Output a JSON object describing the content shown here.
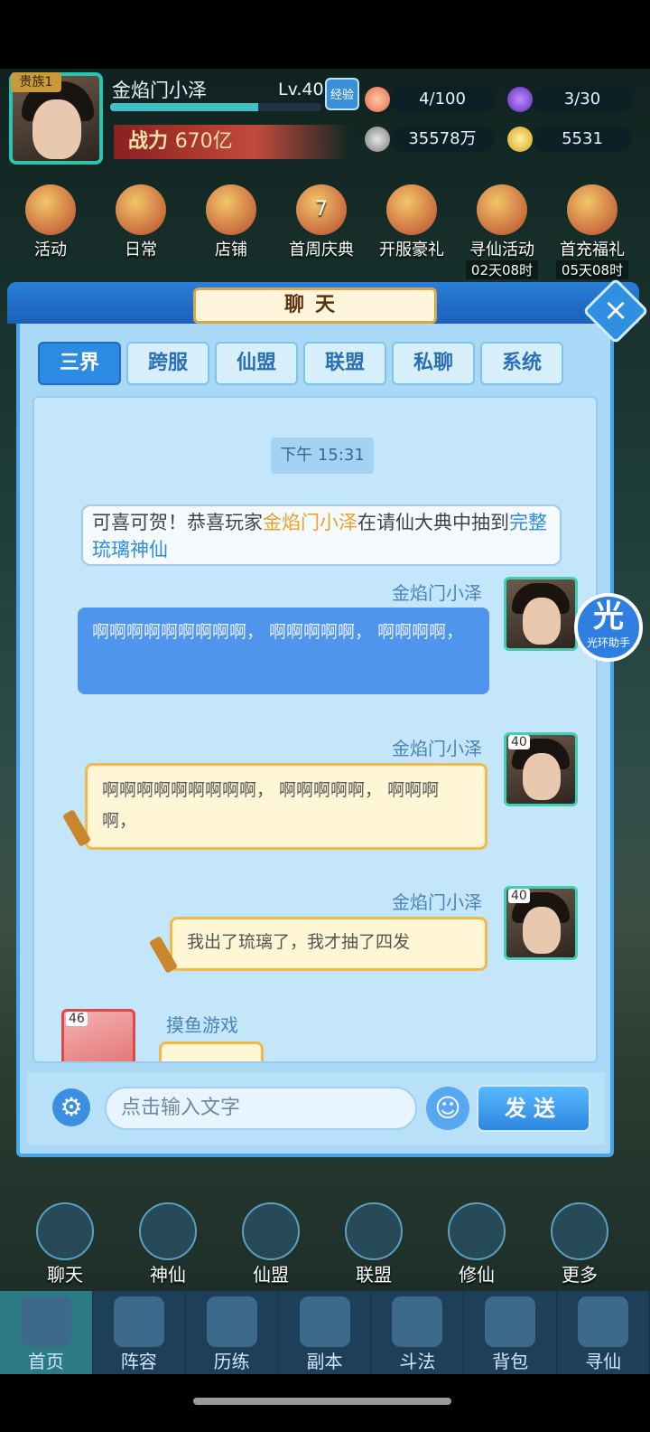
{
  "header": {
    "noble_label": "贵族1",
    "player_name": "金焰门小泽",
    "level": "Lv.40",
    "exp_badge": "经验",
    "exp_progress": 0.7,
    "power_label": "战力",
    "power_value": "670亿",
    "resources": {
      "stamina": "4/100",
      "spirit": "3/30",
      "silver": "35578万",
      "gold": "5531"
    }
  },
  "activities": [
    {
      "label": "活动"
    },
    {
      "label": "日常"
    },
    {
      "label": "店铺"
    },
    {
      "label": "首周庆典",
      "badge": "7"
    },
    {
      "label": "开服豪礼"
    },
    {
      "label": "寻仙活动",
      "timer": "02天08时"
    },
    {
      "label": "首充福礼",
      "timer": "05天08时"
    }
  ],
  "chat": {
    "title": "聊天",
    "close_icon": "×",
    "tabs": [
      "三界",
      "跨服",
      "仙盟",
      "联盟",
      "私聊",
      "系统"
    ],
    "active_tab": "三界",
    "timestamp": "下午 15:31",
    "system_message": {
      "prefix": "可喜可贺！恭喜玩家",
      "player": "金焰门小泽",
      "middle": "在请仙大典中抽到",
      "item": "完整琉璃神仙"
    },
    "messages": [
      {
        "sender": "金焰门小泽",
        "text": "啊啊啊啊啊啊啊啊啊，  啊啊啊啊啊，  啊啊啊啊，",
        "style": "blue"
      },
      {
        "sender": "金焰门小泽",
        "level": "40",
        "text": "啊啊啊啊啊啊啊啊啊，  啊啊啊啊啊，  啊啊啊啊，",
        "style": "gold"
      },
      {
        "sender": "金焰门小泽",
        "level": "40",
        "text": "我出了琉璃了，我才抽了四发",
        "style": "gold"
      },
      {
        "sender": "摸鱼游戏",
        "level": "46",
        "text": "",
        "style": "gold"
      }
    ],
    "input_placeholder": "点击输入文字",
    "send_label": "发送",
    "assistant_label": "光环助手",
    "assistant_glyph": "光"
  },
  "quick_menu": [
    "聊天",
    "神仙",
    "仙盟",
    "联盟",
    "修仙",
    "更多"
  ],
  "bottom_nav": [
    "首页",
    "阵容",
    "历练",
    "副本",
    "斗法",
    "背包",
    "寻仙"
  ],
  "active_nav": "首页",
  "colors": {
    "accent": "#2e8be4",
    "gold": "#f0a020",
    "panel": "#a9d9f7"
  }
}
